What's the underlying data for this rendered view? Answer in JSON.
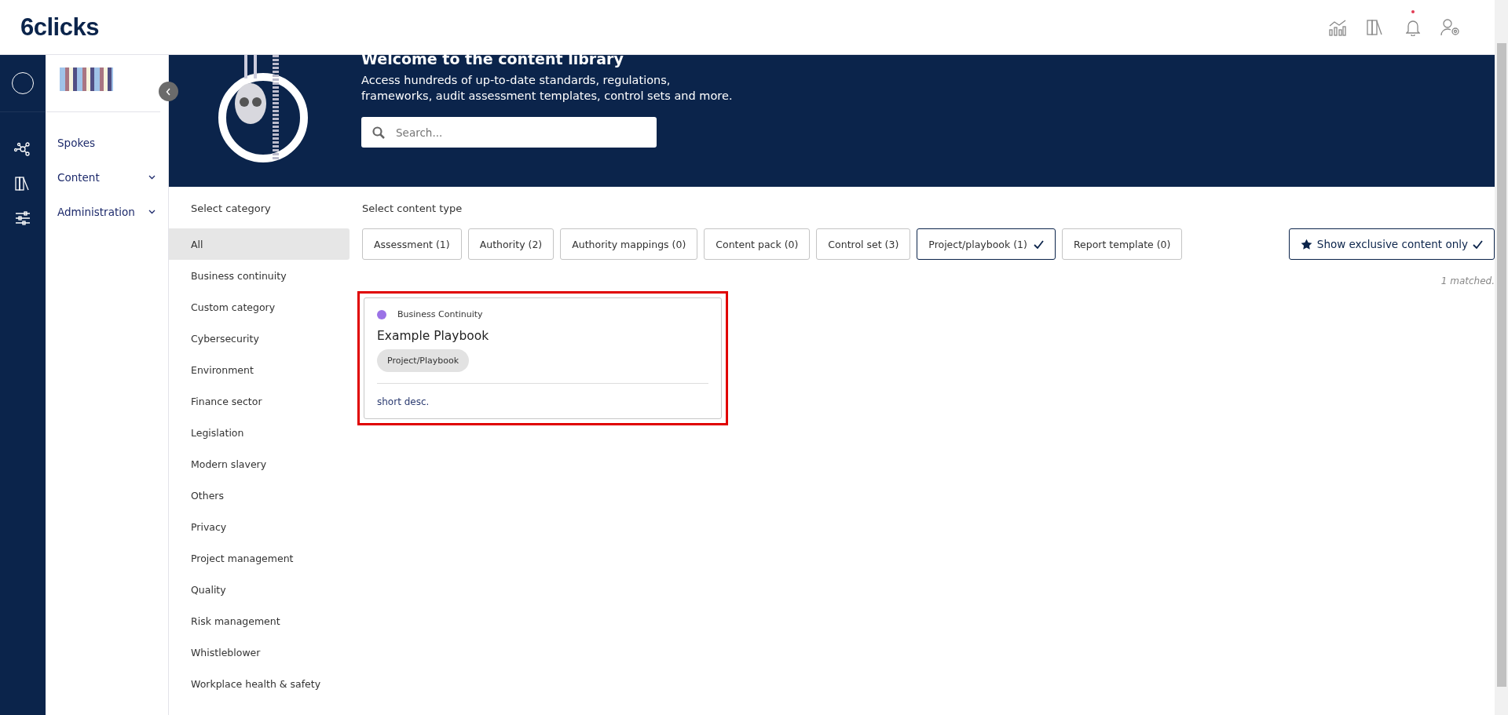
{
  "header": {
    "logo": "6clicks",
    "notification_unread": true
  },
  "sidebar": {
    "items": [
      {
        "label": "Spokes",
        "has_menu": false
      },
      {
        "label": "Content",
        "has_menu": true
      },
      {
        "label": "Administration",
        "has_menu": true
      }
    ]
  },
  "banner": {
    "title": "Welcome to the content library",
    "text": "Access hundreds of up-to-date standards, regulations, frameworks, audit assessment templates, control sets and more.",
    "search": {
      "placeholder": "Search..."
    }
  },
  "categories": {
    "heading": "Select category",
    "items": [
      {
        "label": "All",
        "selected": true
      },
      {
        "label": "Business continuity",
        "selected": false
      },
      {
        "label": "Custom category",
        "selected": false
      },
      {
        "label": "Cybersecurity",
        "selected": false
      },
      {
        "label": "Environment",
        "selected": false
      },
      {
        "label": "Finance sector",
        "selected": false
      },
      {
        "label": "Legislation",
        "selected": false
      },
      {
        "label": "Modern slavery",
        "selected": false
      },
      {
        "label": "Others",
        "selected": false
      },
      {
        "label": "Privacy",
        "selected": false
      },
      {
        "label": "Project management",
        "selected": false
      },
      {
        "label": "Quality",
        "selected": false
      },
      {
        "label": "Risk management",
        "selected": false
      },
      {
        "label": "Whistleblower",
        "selected": false
      },
      {
        "label": "Workplace health & safety",
        "selected": false
      }
    ]
  },
  "content_types": {
    "heading": "Select content type",
    "items": [
      {
        "label": "Assessment (1)",
        "selected": false
      },
      {
        "label": "Authority (2)",
        "selected": false
      },
      {
        "label": "Authority mappings (0)",
        "selected": false
      },
      {
        "label": "Content pack (0)",
        "selected": false
      },
      {
        "label": "Control set (3)",
        "selected": false
      },
      {
        "label": "Project/playbook (1)",
        "selected": true
      },
      {
        "label": "Report template (0)",
        "selected": false
      }
    ]
  },
  "exclusive_toggle": {
    "label": "Show exclusive content only",
    "on": true
  },
  "match_count": "1 matched.",
  "cards": [
    {
      "category": "Business Continuity",
      "color": "#9b72e6",
      "title": "Example Playbook",
      "tag": "Project/Playbook",
      "description": "short desc.",
      "highlighted": true
    }
  ]
}
